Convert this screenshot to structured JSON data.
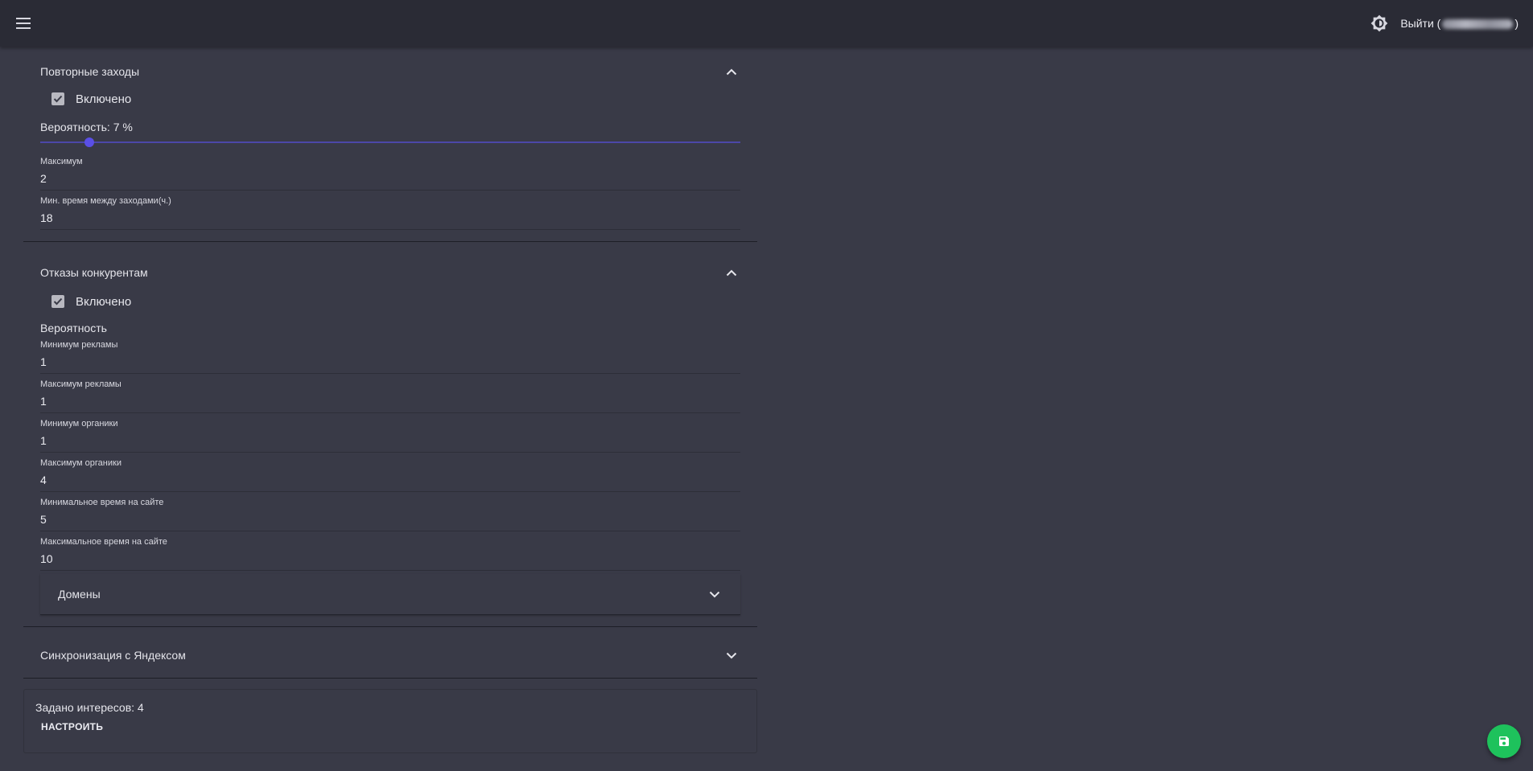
{
  "header": {
    "logout_label": "Выйти (",
    "logout_suffix": ")",
    "icons": {
      "menu": "menu-icon",
      "theme": "brightness-icon"
    }
  },
  "colors": {
    "background": "#393a47",
    "appbar": "#2a2b35",
    "slider_accent": "#5a4fe6",
    "fab": "#1ec25c"
  },
  "repeat_visits": {
    "title": "Повторные заходы",
    "enabled_label": "Включено",
    "enabled": true,
    "probability_label": "Вероятность: 7 %",
    "probability_value": 7,
    "max_label": "Максимум",
    "max_value": "2",
    "min_interval_label": "Мин. время между заходами(ч.)",
    "min_interval_value": "18"
  },
  "competitor_bounces": {
    "title": "Отказы конкурентам",
    "enabled_label": "Включено",
    "enabled": true,
    "probability_label": "Вероятность",
    "fields": [
      {
        "label": "Минимум рекламы",
        "value": "1"
      },
      {
        "label": "Максимум рекламы",
        "value": "1"
      },
      {
        "label": "Минимум органики",
        "value": "1"
      },
      {
        "label": "Максимум органики",
        "value": "4"
      },
      {
        "label": "Минимальное время на сайте",
        "value": "5"
      },
      {
        "label": "Максимальное время на сайте",
        "value": "10"
      }
    ],
    "domains_title": "Домены"
  },
  "yandex_sync": {
    "title": "Синхронизация с Яндексом"
  },
  "interests": {
    "text": "Задано интересов: 4",
    "configure_label": "НАСТРОИТЬ"
  },
  "fab": {
    "icon": "save-icon"
  }
}
